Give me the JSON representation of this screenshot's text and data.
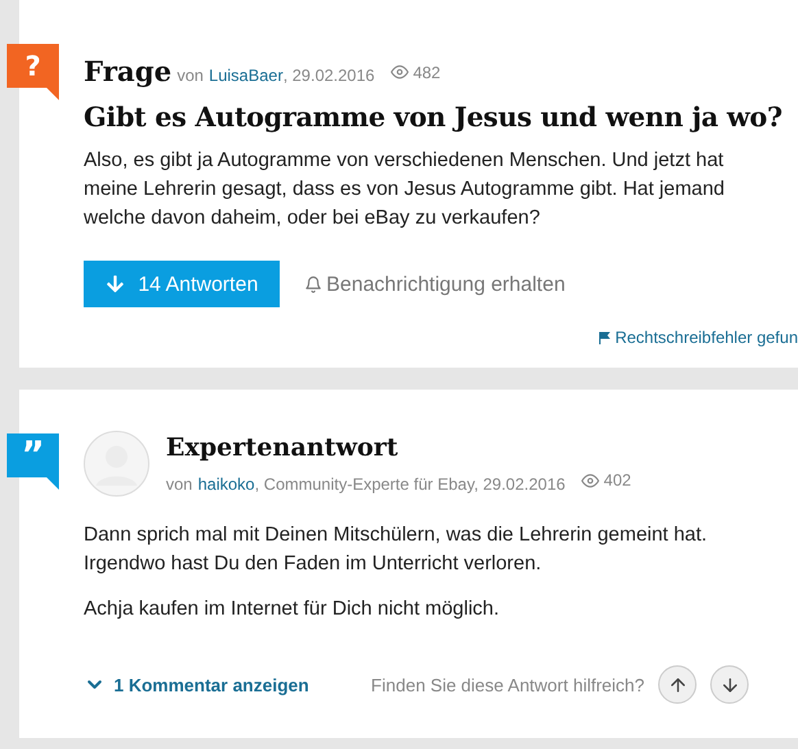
{
  "question": {
    "badge": "?",
    "label": "Frage",
    "by_prefix": "von",
    "author": "LuisaBaer",
    "date": ", 29.02.2016",
    "views": "482",
    "title": "Gibt es Autogramme von Jesus und wenn ja wo?",
    "body": "Also, es gibt ja Autogramme von verschiedenen Menschen. Und jetzt hat meine Lehrerin gesagt, dass es von Jesus Autogramme gibt. Hat jemand welche davon daheim, oder bei eBay zu verkaufen?",
    "answers_button": "14 Antworten",
    "notify_link": "Benachrichtigung erhalten",
    "report_link": "Rechtschreibfehler gefun"
  },
  "answer": {
    "badge": "”",
    "label": "Expertenantwort",
    "by_prefix": "von",
    "author": "haikoko",
    "role": ", Community-Experte für Ebay, 29.02.2016",
    "views": "402",
    "paragraphs": [
      "Dann sprich mal mit Deinen Mitschülern, was die Lehrerin gemeint hat. Irgendwo hast Du den Faden im Unterricht verloren.",
      "Achja kaufen im Internet für Dich nicht möglich."
    ],
    "comments_link": "1 Kommentar anzeigen",
    "helpful_prompt": "Finden Sie diese Antwort hilfreich?"
  }
}
